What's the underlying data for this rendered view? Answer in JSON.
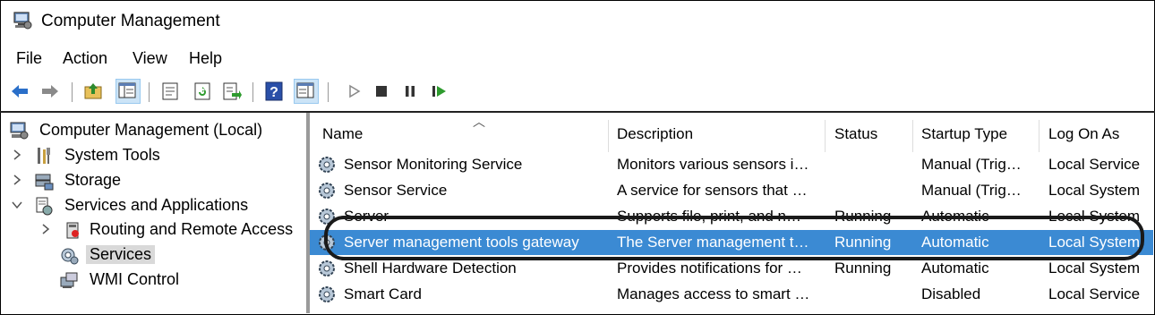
{
  "window": {
    "title": "Computer Management"
  },
  "menu": [
    "File",
    "Action",
    "View",
    "Help"
  ],
  "tree": [
    {
      "label": "Computer Management (Local)",
      "icon": "computer-management-icon"
    },
    {
      "label": "System Tools",
      "icon": "system-tools-icon"
    },
    {
      "label": "Storage",
      "icon": "storage-icon"
    },
    {
      "label": "Services and Applications",
      "icon": "services-applications-icon"
    },
    {
      "label": "Routing and Remote Access",
      "icon": "routing-remote-access-icon"
    },
    {
      "label": "Services",
      "icon": "services-icon"
    },
    {
      "label": "WMI Control",
      "icon": "wmi-control-icon"
    }
  ],
  "columns": [
    "Name",
    "Description",
    "Status",
    "Startup Type",
    "Log On As"
  ],
  "services": [
    {
      "name": "Sensor Monitoring Service",
      "description": "Monitors various sensors i…",
      "status": "",
      "startup": "Manual (Trig…",
      "logon": "Local Service"
    },
    {
      "name": "Sensor Service",
      "description": "A service for sensors that …",
      "status": "",
      "startup": "Manual (Trig…",
      "logon": "Local System"
    },
    {
      "name": "Server",
      "description": "Supports file, print, and n…",
      "status": "Running",
      "startup": "Automatic",
      "logon": "Local System"
    },
    {
      "name": "Server management tools gateway",
      "description": "The Server management t…",
      "status": "Running",
      "startup": "Automatic",
      "logon": "Local System"
    },
    {
      "name": "Shell Hardware Detection",
      "description": "Provides notifications for …",
      "status": "Running",
      "startup": "Automatic",
      "logon": "Local System"
    },
    {
      "name": "Smart Card",
      "description": "Manages access to smart …",
      "status": "",
      "startup": "Disabled",
      "logon": "Local Service"
    }
  ],
  "colors": {
    "selection": "#3b8ad3",
    "tree_selection": "#d9d9d9"
  }
}
